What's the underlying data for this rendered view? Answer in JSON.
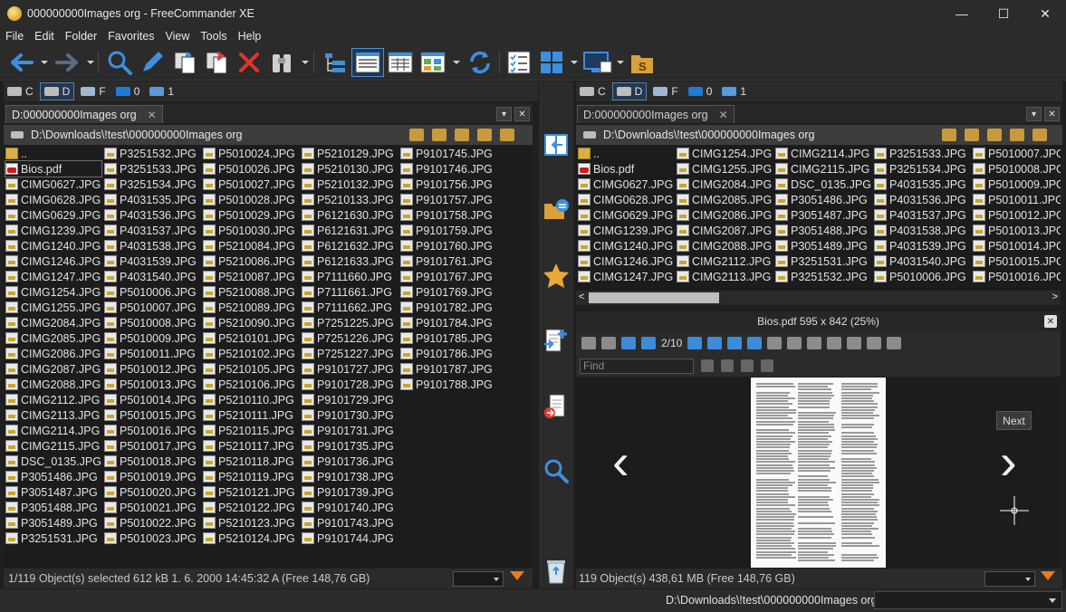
{
  "window": {
    "title": "000000000Images org - FreeCommander XE",
    "minimize": "—",
    "maximize": "☐",
    "close": "✕"
  },
  "menu": [
    "File",
    "Edit",
    "Folder",
    "Favorites",
    "View",
    "Tools",
    "Help"
  ],
  "drives": [
    {
      "label": "C",
      "selected": false
    },
    {
      "label": "D",
      "selected": true
    },
    {
      "label": "F",
      "selected": false
    },
    {
      "label": "0",
      "selected": false
    },
    {
      "label": "1",
      "selected": false
    }
  ],
  "left_panel": {
    "tab": "D:000000000Images org",
    "path": "D:\\Downloads\\!test\\000000000Images org",
    "columns": [
      [
        "..",
        "Bios.pdf",
        "CIMG0627.JPG",
        "CIMG0628.JPG",
        "CIMG0629.JPG",
        "CIMG1239.JPG",
        "CIMG1240.JPG",
        "CIMG1246.JPG",
        "CIMG1247.JPG",
        "CIMG1254.JPG",
        "CIMG1255.JPG",
        "CIMG2084.JPG",
        "CIMG2085.JPG",
        "CIMG2086.JPG",
        "CIMG2087.JPG",
        "CIMG2088.JPG",
        "CIMG2112.JPG",
        "CIMG2113.JPG",
        "CIMG2114.JPG",
        "CIMG2115.JPG",
        "DSC_0135.JPG",
        "P3051486.JPG",
        "P3051487.JPG",
        "P3051488.JPG",
        "P3051489.JPG",
        "P3251531.JPG"
      ],
      [
        "P3251532.JPG",
        "P3251533.JPG",
        "P3251534.JPG",
        "P4031535.JPG",
        "P4031536.JPG",
        "P4031537.JPG",
        "P4031538.JPG",
        "P4031539.JPG",
        "P4031540.JPG",
        "P5010006.JPG",
        "P5010007.JPG",
        "P5010008.JPG",
        "P5010009.JPG",
        "P5010011.JPG",
        "P5010012.JPG",
        "P5010013.JPG",
        "P5010014.JPG",
        "P5010015.JPG",
        "P5010016.JPG",
        "P5010017.JPG",
        "P5010018.JPG",
        "P5010019.JPG",
        "P5010020.JPG",
        "P5010021.JPG",
        "P5010022.JPG",
        "P5010023.JPG"
      ],
      [
        "P5010024.JPG",
        "P5010026.JPG",
        "P5010027.JPG",
        "P5010028.JPG",
        "P5010029.JPG",
        "P5010030.JPG",
        "P5210084.JPG",
        "P5210086.JPG",
        "P5210087.JPG",
        "P5210088.JPG",
        "P5210089.JPG",
        "P5210090.JPG",
        "P5210101.JPG",
        "P5210102.JPG",
        "P5210105.JPG",
        "P5210106.JPG",
        "P5210110.JPG",
        "P5210111.JPG",
        "P5210115.JPG",
        "P5210117.JPG",
        "P5210118.JPG",
        "P5210119.JPG",
        "P5210121.JPG",
        "P5210122.JPG",
        "P5210123.JPG",
        "P5210124.JPG"
      ],
      [
        "P5210129.JPG",
        "P5210130.JPG",
        "P5210132.JPG",
        "P5210133.JPG",
        "P6121630.JPG",
        "P6121631.JPG",
        "P6121632.JPG",
        "P6121633.JPG",
        "P7111660.JPG",
        "P7111661.JPG",
        "P7111662.JPG",
        "P7251225.JPG",
        "P7251226.JPG",
        "P7251227.JPG",
        "P9101727.JPG",
        "P9101728.JPG",
        "P9101729.JPG",
        "P9101730.JPG",
        "P9101731.JPG",
        "P9101735.JPG",
        "P9101736.JPG",
        "P9101738.JPG",
        "P9101739.JPG",
        "P9101740.JPG",
        "P9101743.JPG",
        "P9101744.JPG"
      ],
      [
        "P9101745.JPG",
        "P9101746.JPG",
        "P9101756.JPG",
        "P9101757.JPG",
        "P9101758.JPG",
        "P9101759.JPG",
        "P9101760.JPG",
        "P9101761.JPG",
        "P9101767.JPG",
        "P9101769.JPG",
        "P9101782.JPG",
        "P9101784.JPG",
        "P9101785.JPG",
        "P9101786.JPG",
        "P9101787.JPG",
        "P9101788.JPG"
      ]
    ],
    "status": "1/119 Object(s) selected   612 kB   1. 6. 2000 14:45:32   A   (Free 148,76 GB)"
  },
  "right_panel": {
    "tab": "D:000000000Images org",
    "path": "D:\\Downloads\\!test\\000000000Images org",
    "columns": [
      [
        "..",
        "Bios.pdf",
        "CIMG0627.JPG",
        "CIMG0628.JPG",
        "CIMG0629.JPG",
        "CIMG1239.JPG",
        "CIMG1240.JPG",
        "CIMG1246.JPG",
        "CIMG1247.JPG"
      ],
      [
        "CIMG1254.JPG",
        "CIMG1255.JPG",
        "CIMG2084.JPG",
        "CIMG2085.JPG",
        "CIMG2086.JPG",
        "CIMG2087.JPG",
        "CIMG2088.JPG",
        "CIMG2112.JPG",
        "CIMG2113.JPG"
      ],
      [
        "CIMG2114.JPG",
        "CIMG2115.JPG",
        "DSC_0135.JPG",
        "P3051486.JPG",
        "P3051487.JPG",
        "P3051488.JPG",
        "P3051489.JPG",
        "P3251531.JPG",
        "P3251532.JPG"
      ],
      [
        "P3251533.JPG",
        "P3251534.JPG",
        "P4031535.JPG",
        "P4031536.JPG",
        "P4031537.JPG",
        "P4031538.JPG",
        "P4031539.JPG",
        "P4031540.JPG",
        "P5010006.JPG"
      ],
      [
        "P5010007.JPG",
        "P5010008.JPG",
        "P5010009.JPG",
        "P5010011.JPG",
        "P5010012.JPG",
        "P5010013.JPG",
        "P5010014.JPG",
        "P5010015.JPG",
        "P5010016.JPG"
      ]
    ],
    "status": "119 Object(s)   438,61 MB   (Free 148,76 GB)"
  },
  "viewer": {
    "title": "Bios.pdf   595 x 842 (25%)",
    "page": "2/10",
    "find_placeholder": "Find",
    "next_label": "Next",
    "prev_arrow": "‹",
    "next_arrow": "›"
  },
  "bottom": {
    "path": "D:\\Downloads\\!test\\000000000Images org\\"
  }
}
